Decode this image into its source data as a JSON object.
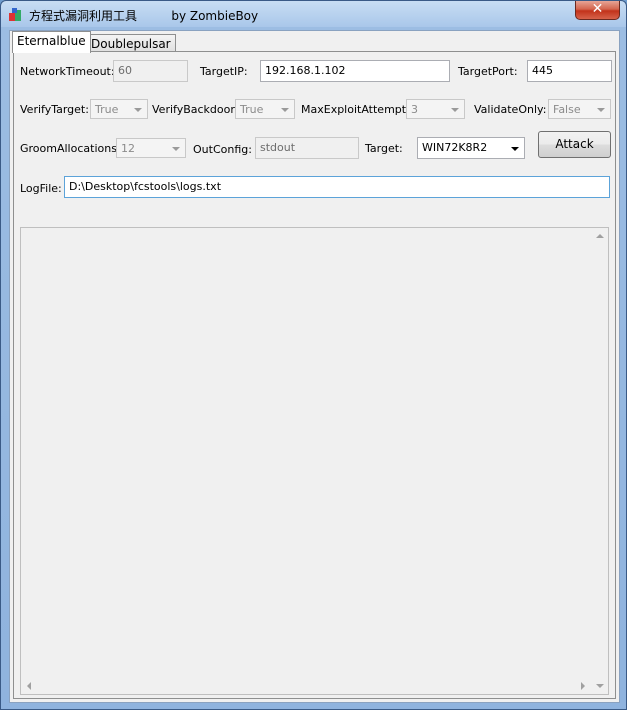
{
  "window": {
    "title": "方程式漏洞利用工具         by ZombieBoy",
    "close_glyph": "✕"
  },
  "tabs": [
    {
      "label": "Eternalblue"
    },
    {
      "label": "Doublepulsar"
    }
  ],
  "row1": {
    "network_timeout_label": "NetworkTimeout:",
    "network_timeout_value": "60",
    "target_ip_label": "TargetIP:",
    "target_ip_value": "192.168.1.102",
    "target_port_label": "TargetPort:",
    "target_port_value": "445"
  },
  "row2": {
    "verify_target_label": "VerifyTarget:",
    "verify_target_value": "True",
    "verify_backdoor_label": "VerifyBackdoor:",
    "verify_backdoor_value": "True",
    "max_exploit_label": "MaxExploitAttempts:",
    "max_exploit_value": "3",
    "validate_only_label": "ValidateOnly:",
    "validate_only_value": "False"
  },
  "row3": {
    "groom_label": "GroomAllocations:",
    "groom_value": "12",
    "out_config_label": "OutConfig:",
    "out_config_value": "stdout",
    "target_label": "Target:",
    "target_value": "WIN72K8R2",
    "attack_label": "Attack"
  },
  "row4": {
    "log_file_label": "LogFile:",
    "log_file_value": "D:\\Desktop\\fcstools\\logs.txt"
  },
  "colors": {
    "titlebar": "#a9c7ea",
    "close_button": "#c2331b",
    "panel": "#f0f0f0"
  },
  "icons": {
    "app": "app-icon",
    "close": "close-icon"
  }
}
